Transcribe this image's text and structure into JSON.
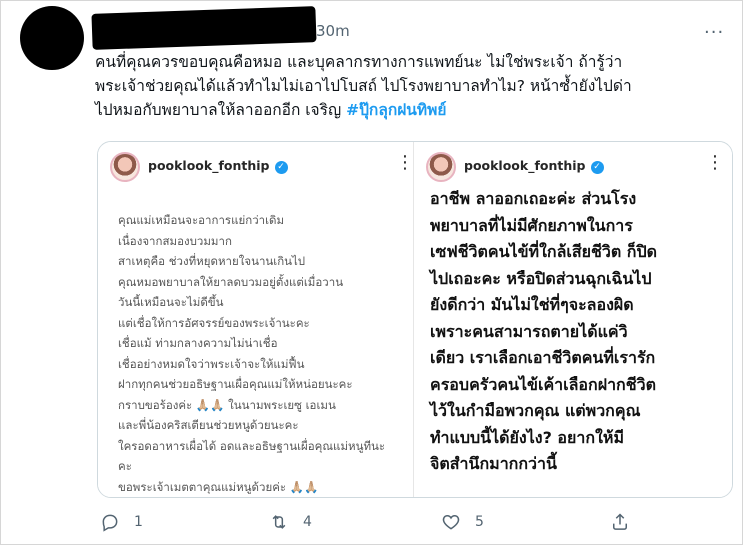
{
  "tweet": {
    "time": "30m",
    "more_icon": "···",
    "text_lines": [
      "คนที่คุณควรขอบคุณคือหมอ และบุคลากรทางการแพทย์นะ ไม่ใช่พระเจ้า  ถ้ารู้ว่า",
      "พระเจ้าช่วยคุณได้แล้วทำไมไม่เอาไปโบสถ์ ไปโรงพยาบาลทำไม? หน้าซ้ำยังไปด่า",
      "ไปหมอกับพยาบาลให้ลาออกอีก เจริญ "
    ],
    "hashtag": "#ปุ๊กลุกฝนทิพย์"
  },
  "media": {
    "left": {
      "username": "pooklook_fonthip",
      "verified_icon": "✓",
      "more_icon": "⋮",
      "lines": [
        "คุณแม่เหมือนจะอาการแย่กว่าเดิม",
        "เนื่องจากสมองบวมมาก",
        "สาเหตุคือ ช่วงที่หยุดหายใจนานเกินไป",
        "คุณหมอพยาบาลให้ยาลดบวมอยู่ตั้งแต่เมื่อวาน",
        "วันนี้เหมือนจะไม่ดีขึ้น",
        "แต่เชื่อให้การอัศจรรย์ของพระเจ้านะคะ",
        "เชื่อแม้ ท่ามกลางความไม่น่าเชื่อ",
        "เชื่ออย่างหมดใจว่าพระเจ้าจะให้แม่ฟื้น",
        "ฝากทุกคนช่วยอธิษฐานเผื่อคุณแม่ให้หน่อยนะคะ",
        "กราบขอร้องค่ะ 🙏🏼🙏🏼 ในนามพระเยซู เอเมน",
        "และพี่น้องคริสเตียนช่วยหนูด้วยนะคะ",
        "ใครอดอาหารเผื่อได้ อดและอธิษฐานเผื่อคุณแม่หนูทีนะ",
        "คะ",
        "ขอพระเจ้าเมตตาคุณแม่หนูด้วยค่ะ 🙏🏼🙏🏼"
      ]
    },
    "right": {
      "username": "pooklook_fonthip",
      "verified_icon": "✓",
      "more_icon": "⋮",
      "lines": [
        "อาชีพ ลาออกเถอะค่ะ ส่วนโรง",
        "พยาบาลที่ไม่มีศักยภาพในการ",
        "เซฟชีวิตคนไข้ที่ใกล้เสียชีวิต ก็ปิด",
        "ไปเถอะคะ หรือปิดส่วนฉุกเฉินไป",
        "ยังดีกว่า มันไม่ใช่ที่ๆจะลองผิด",
        "เพราะคนสามารถตายได้แค่วิ",
        "เดียว เราเลือกเอาชีวิตคนที่เรารัก",
        "ครอบครัวคนไข้เค้าเลือกฝากชีวิต",
        "ไว้ในกำมือพวกคุณ แต่พวกคุณ",
        "ทำแบบนี้ได้ยังไง? อยากให้มี",
        "จิตสำนึกมากกว่านี้"
      ]
    }
  },
  "actions": {
    "reply_count": "1",
    "retweet_count": "4",
    "like_count": "5"
  }
}
